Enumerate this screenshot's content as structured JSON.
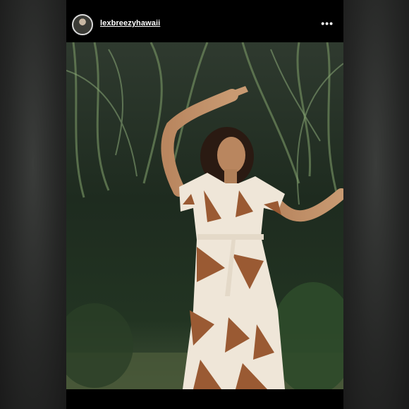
{
  "post": {
    "username": "lexbreezyhawaii",
    "more_label": "•••",
    "avatar_icon": "profile-avatar",
    "photo_subject": "photo"
  },
  "colors": {
    "background": "#000000",
    "text": "#ffffff",
    "dress_base": "#efe6d8",
    "dress_pattern": "#9a5a33"
  }
}
